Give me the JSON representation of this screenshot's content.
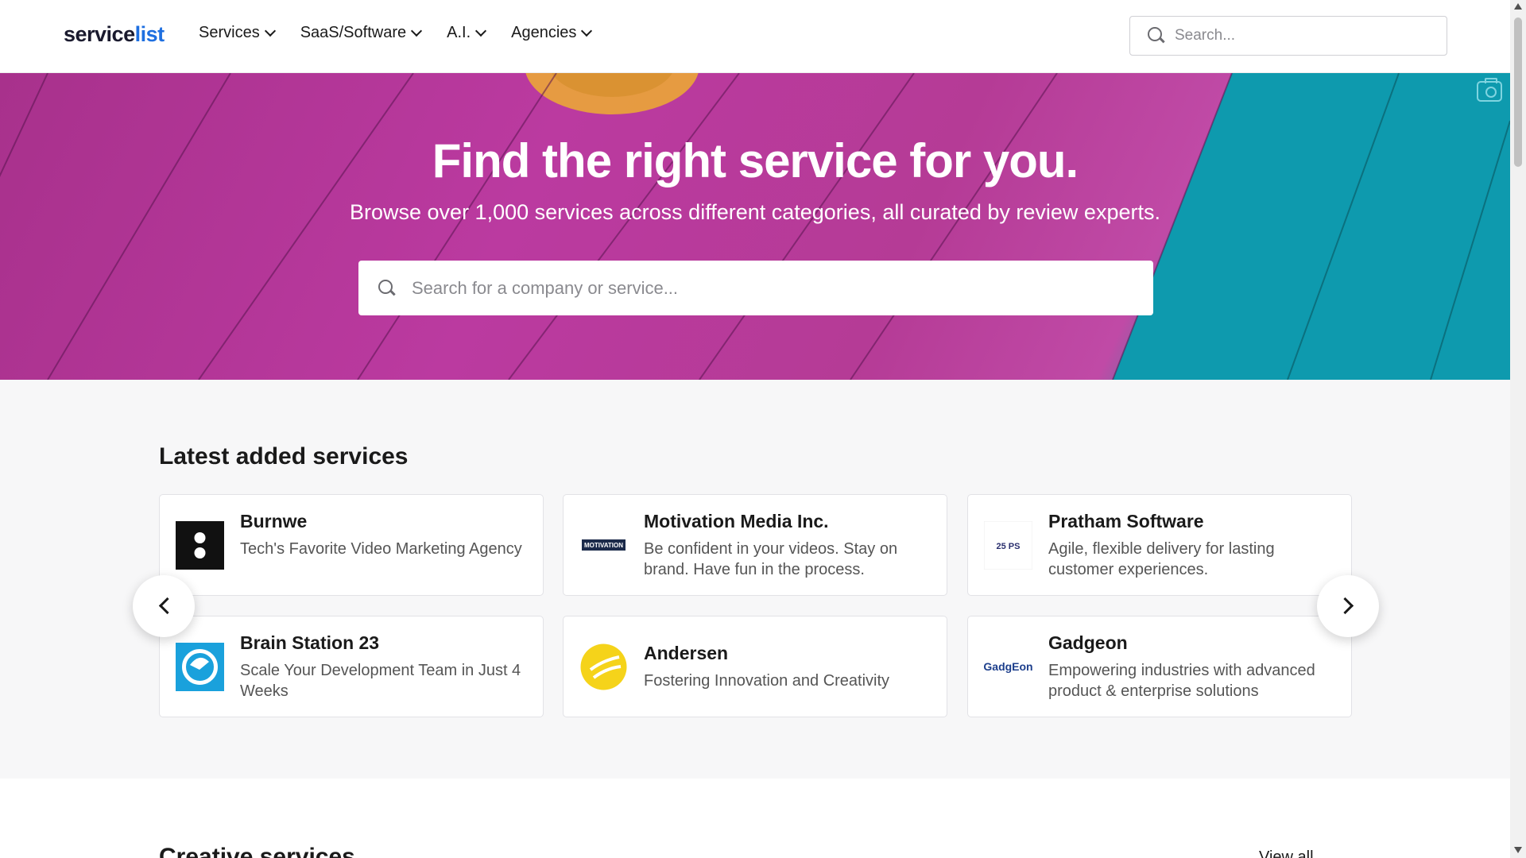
{
  "header": {
    "logo_part1": "service",
    "logo_part2": "list",
    "nav": [
      {
        "label": "Services"
      },
      {
        "label": "SaaS/Software"
      },
      {
        "label": "A.I."
      },
      {
        "label": "Agencies"
      }
    ],
    "search_placeholder": "Search..."
  },
  "hero": {
    "title": "Find the right service for you.",
    "subtitle": "Browse over 1,000 services across different categories, all curated by review experts.",
    "search_placeholder": "Search for a company or service..."
  },
  "latest": {
    "title": "Latest added services",
    "cards": [
      {
        "name": "Burnwe",
        "desc": "Tech's Favorite Video Marketing Agency"
      },
      {
        "name": "Motivation Media Inc.",
        "desc": "Be confident in your videos. Stay on brand. Have fun in the process.",
        "logo_text": "MOTIVATION"
      },
      {
        "name": "Pratham Software",
        "desc": "Agile, flexible delivery for lasting customer experiences.",
        "logo_text": "25 PS"
      },
      {
        "name": "Brain Station 23",
        "desc": "Scale Your Development Team in Just 4 Weeks"
      },
      {
        "name": "Andersen",
        "desc": "Fostering Innovation and Creativity"
      },
      {
        "name": "Gadgeon",
        "desc": "Empowering industries with advanced product & enterprise solutions",
        "logo_text": "GadgEon"
      }
    ]
  },
  "creative": {
    "title": "Creative services",
    "view_all": "View all"
  },
  "colors": {
    "brand_blue": "#1e6fe0",
    "hero_magenta": "#b53b96",
    "hero_teal": "#0e9aae"
  }
}
